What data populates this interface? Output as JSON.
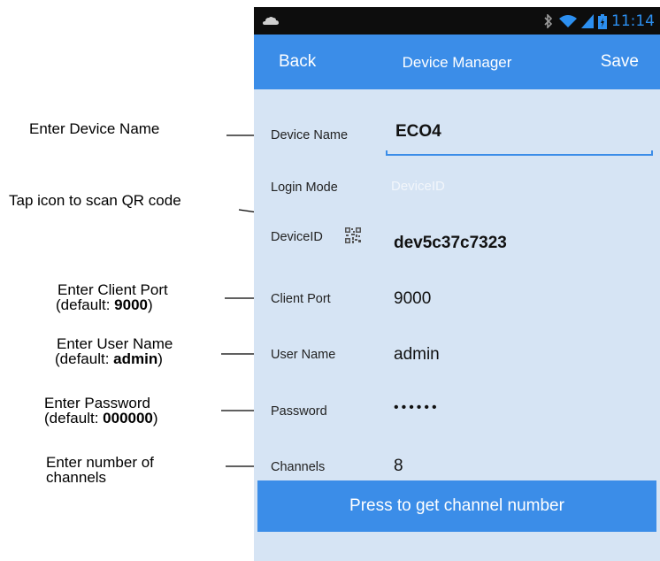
{
  "status_bar": {
    "time": "11:14"
  },
  "app_bar": {
    "back": "Back",
    "title": "Device Manager",
    "save": "Save"
  },
  "fields": {
    "device_name": {
      "label": "Device Name",
      "value": "ECO4"
    },
    "login_mode": {
      "label": "Login Mode",
      "value": "DeviceID"
    },
    "device_id": {
      "label": "DeviceID",
      "value": "dev5c37c7323"
    },
    "client_port": {
      "label": "Client Port",
      "value": "9000"
    },
    "user_name": {
      "label": "User Name",
      "value": "admin"
    },
    "password": {
      "label": "Password",
      "value": "••••••"
    },
    "channels": {
      "label": "Channels",
      "value": "8"
    }
  },
  "button": {
    "label": "Press to get channel number"
  },
  "annotations": {
    "device_name": "Enter Device Name",
    "qr": "Tap icon to scan QR code",
    "client_port": {
      "line1": "Enter Client Port",
      "prefix": "(default: ",
      "bold": "9000",
      "suffix": ")"
    },
    "user_name": {
      "line1": "Enter User Name",
      "prefix": "(default: ",
      "bold": "admin",
      "suffix": ")"
    },
    "password": {
      "line1": "Enter Password",
      "prefix": "(default: ",
      "bold": "000000",
      "suffix": ")"
    },
    "channels": {
      "line1": "Enter number of",
      "line2": "channels"
    }
  },
  "colors": {
    "accent": "#3b8de8",
    "background": "#d6e4f4",
    "status_time": "#2c8ff0"
  }
}
